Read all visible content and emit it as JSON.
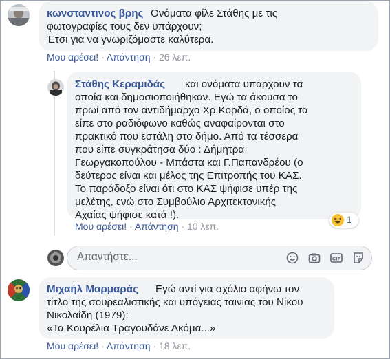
{
  "comments": [
    {
      "author": "κωνσταντινος βρης",
      "lines": [
        "Ονόματα φίλε Στάθης με τις",
        "φωτογραφίες τους δεν υπάρχουν;",
        "Έτσι για να γνωριζόμαστε καλύτερα."
      ],
      "like": "Μου αρέσει!",
      "reply": "Απάντηση",
      "time": "26 λεπ."
    },
    {
      "author": "Στάθης Κεραμιδάς",
      "lines": [
        "και ονόματα υπάρχουν τα",
        "οποία και δημοσιοποιήθηκαν. Εγώ τα άκουσα το",
        "πρωί από τον αντιδήμαρχο Χρ.Κορδά, ο οποίος τα",
        "είπε στο ραδιόφωνο καθώς αναφαίρονται στο",
        "πρακτικό που εστάλη στο δήμο. Από τα τέσσερα",
        "που είπε συγκράτησα δύο : Δήμητρα",
        "Γεωργακοπούλου - Μπάστα και Γ.Παπανδρέου (ο",
        "δεύτερος είναι και μέλος της Επιτροπής του ΚΑΣ.",
        "Το παράδοξο είναι ότι στο ΚΑΣ ψήφισε υπέρ της",
        "μελέτης, ενώ στο Συμβούλιο Αρχιτεκτονικής",
        "Αχαίας ψήφισε κατά !)."
      ],
      "like": "Μου αρέσει!",
      "reply": "Απάντηση",
      "time": "10 λεπ.",
      "reaction_count": "1"
    },
    {
      "author": "Μιχαήλ Μαρμαράς",
      "lines": [
        "Εγώ αντί για σχόλιο αφήνω τον",
        "τίτλο της σουρεαλιστικής και υπόγειας ταινίας του Νίκου",
        "Νικολαΐδη (1979):",
        "«Τα Κουρέλια Τραγουδάνε Ακόμα...»"
      ],
      "like": "Μου αρέσει!",
      "reply": "Απάντηση",
      "time": "18 λεπ."
    }
  ],
  "reply_input": {
    "placeholder": "Απαντήστε..."
  },
  "separator": "·",
  "colors": {
    "name": "#385898",
    "bubble": "#f2f3f5",
    "meta": "#90949c"
  }
}
